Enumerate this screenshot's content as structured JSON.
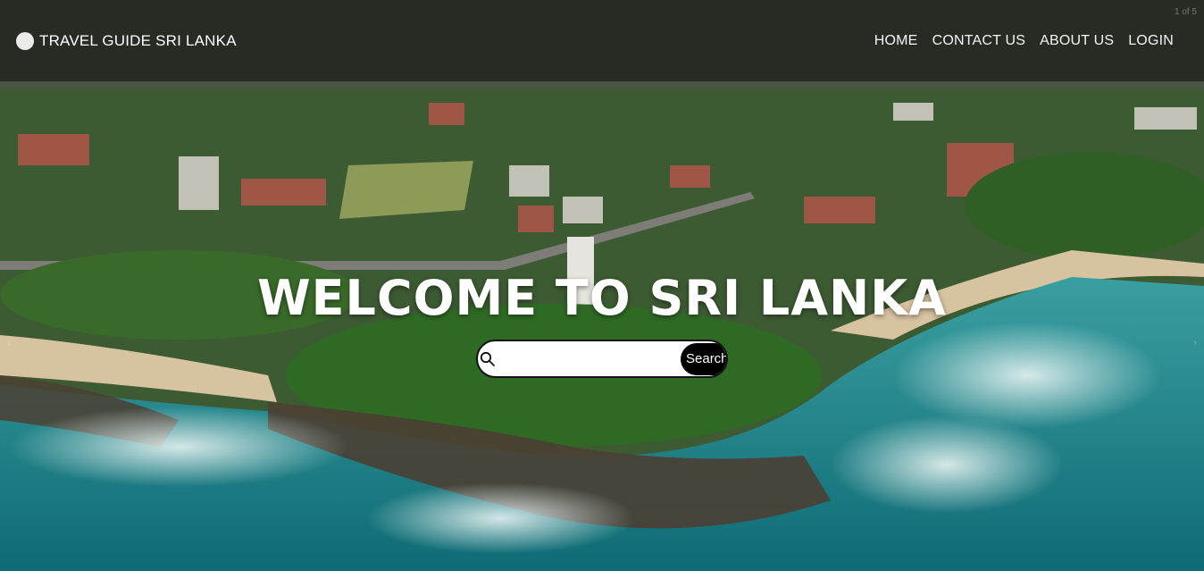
{
  "header": {
    "brand": "TRAVEL GUIDE SRI LANKA",
    "nav": [
      "HOME",
      "CONTACT US",
      "ABOUT US",
      "LOGIN"
    ],
    "slide_indicator": "1 of 5"
  },
  "hero": {
    "headline": "WELCOME TO SRI LANKA",
    "image": "aerial-coastal-town-lighthouse"
  },
  "search": {
    "placeholder": "",
    "value": "",
    "button_label": "Search",
    "icon": "search-icon"
  },
  "colors": {
    "header_bg": "#0a0a0a",
    "search_button_bg": "#000000",
    "headline": "#ffffff"
  }
}
